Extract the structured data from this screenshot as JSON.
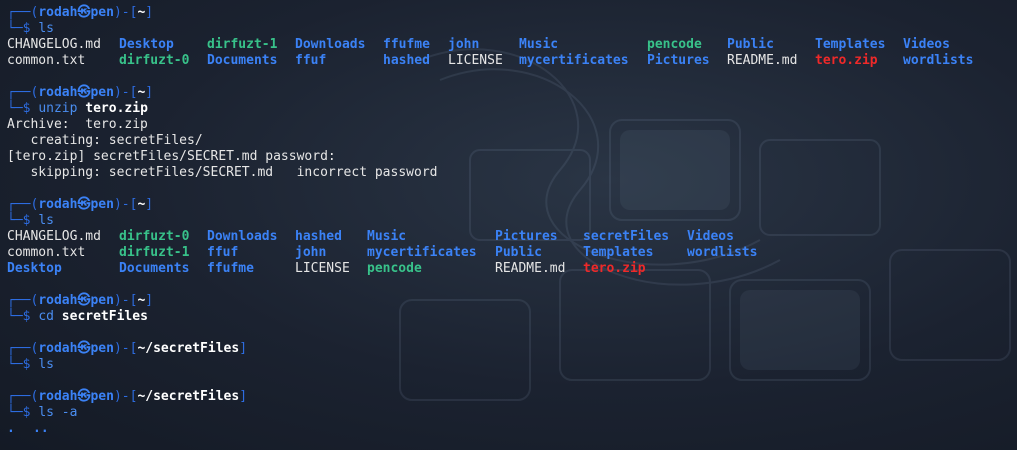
{
  "prompt": {
    "user": "rodah",
    "at": "㉿",
    "host": "pen",
    "top_left": "┌──(",
    "top_mid": ")-[",
    "top_right": "]",
    "bottom": "└─$ "
  },
  "blocks": [
    {
      "cwd": "~",
      "command": "ls",
      "argument": "",
      "rows": [
        [
          {
            "text": "CHANGELOG.md",
            "kind": "file"
          },
          {
            "text": "Desktop",
            "kind": "dir"
          },
          {
            "text": "dirfuzt-1",
            "kind": "dirw"
          },
          {
            "text": "Downloads",
            "kind": "dir"
          },
          {
            "text": "ffufme",
            "kind": "dir"
          },
          {
            "text": "john",
            "kind": "dir"
          },
          {
            "text": "Music",
            "kind": "dir"
          },
          {
            "text": "pencode",
            "kind": "dirw"
          },
          {
            "text": "Public",
            "kind": "dir"
          },
          {
            "text": "Templates",
            "kind": "dir"
          },
          {
            "text": "Videos",
            "kind": "dir"
          }
        ],
        [
          {
            "text": "common.txt",
            "kind": "file"
          },
          {
            "text": "dirfuzt-0",
            "kind": "dirw"
          },
          {
            "text": "Documents",
            "kind": "dir"
          },
          {
            "text": "ffuf",
            "kind": "dir"
          },
          {
            "text": "hashed",
            "kind": "dir"
          },
          {
            "text": "LICENSE",
            "kind": "file"
          },
          {
            "text": "mycertificates",
            "kind": "dir"
          },
          {
            "text": "Pictures",
            "kind": "dir"
          },
          {
            "text": "README.md",
            "kind": "file"
          },
          {
            "text": "tero.zip",
            "kind": "zip"
          },
          {
            "text": "wordlists",
            "kind": "dir"
          }
        ]
      ]
    },
    {
      "cwd": "~",
      "command": "unzip",
      "argument": "tero.zip",
      "output": [
        "Archive:  tero.zip",
        "   creating: secretFiles/",
        "[tero.zip] secretFiles/SECRET.md password:",
        "   skipping: secretFiles/SECRET.md   incorrect password"
      ]
    },
    {
      "cwd": "~",
      "command": "ls",
      "argument": "",
      "rows": [
        [
          {
            "text": "CHANGELOG.md",
            "kind": "file"
          },
          {
            "text": "dirfuzt-0",
            "kind": "dirw"
          },
          {
            "text": "Downloads",
            "kind": "dir"
          },
          {
            "text": "hashed",
            "kind": "dir"
          },
          {
            "text": "Music",
            "kind": "dir"
          },
          {
            "text": "Pictures",
            "kind": "dir"
          },
          {
            "text": "secretFiles",
            "kind": "dir"
          },
          {
            "text": "Videos",
            "kind": "dir"
          }
        ],
        [
          {
            "text": "common.txt",
            "kind": "file"
          },
          {
            "text": "dirfuzt-1",
            "kind": "dirw"
          },
          {
            "text": "ffuf",
            "kind": "dir"
          },
          {
            "text": "john",
            "kind": "dir"
          },
          {
            "text": "mycertificates",
            "kind": "dir"
          },
          {
            "text": "Public",
            "kind": "dir"
          },
          {
            "text": "Templates",
            "kind": "dir"
          },
          {
            "text": "wordlists",
            "kind": "dir"
          }
        ],
        [
          {
            "text": "Desktop",
            "kind": "dir"
          },
          {
            "text": "Documents",
            "kind": "dir"
          },
          {
            "text": "ffufme",
            "kind": "dir"
          },
          {
            "text": "LICENSE",
            "kind": "file"
          },
          {
            "text": "pencode",
            "kind": "dirw"
          },
          {
            "text": "README.md",
            "kind": "file"
          },
          {
            "text": "tero.zip",
            "kind": "zip"
          }
        ]
      ]
    },
    {
      "cwd": "~",
      "command": "cd",
      "argument": "secretFiles"
    },
    {
      "cwd": "~/secretFiles",
      "command": "ls",
      "argument": ""
    },
    {
      "cwd": "~/secretFiles",
      "command": "ls -a",
      "argument": "",
      "rows": [
        [
          {
            "text": ".",
            "kind": "dir"
          },
          {
            "text": "..",
            "kind": "dir"
          }
        ]
      ]
    }
  ],
  "colors": {
    "prompt_frame": "#2d6ce0",
    "directory": "#3b82f6",
    "world_writable_dir": "#38c28a",
    "archive": "#ef2929",
    "plain_file": "#e6e6e6"
  }
}
